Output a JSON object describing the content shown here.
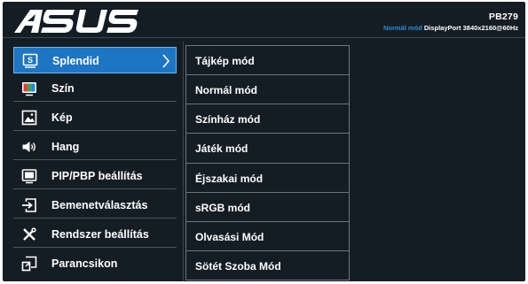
{
  "header": {
    "brand": "ASUS",
    "model": "PB279",
    "status": {
      "mode": "Normál mód",
      "port": "DisplayPort",
      "resolution": "3840x2160@60Hz"
    }
  },
  "menu": {
    "items": [
      {
        "label": "Splendid",
        "icon": "splendid-icon",
        "selected": true
      },
      {
        "label": "Szín",
        "icon": "color-icon"
      },
      {
        "label": "Kép",
        "icon": "image-icon"
      },
      {
        "label": "Hang",
        "icon": "speaker-icon"
      },
      {
        "label": "PIP/PBP beállítás",
        "icon": "pip-icon"
      },
      {
        "label": "Bemenetválasztás",
        "icon": "input-icon"
      },
      {
        "label": "Rendszer beállítás",
        "icon": "tools-icon"
      },
      {
        "label": "Parancsikon",
        "icon": "shortcut-icon"
      }
    ]
  },
  "submenu": {
    "items": [
      {
        "label": "Tájkép mód"
      },
      {
        "label": "Normál mód"
      },
      {
        "label": "Színház mód"
      },
      {
        "label": "Játék mód"
      },
      {
        "label": "Éjszakai mód"
      },
      {
        "label": "sRGB mód"
      },
      {
        "label": "Olvasási Mód"
      },
      {
        "label": "Sötét Szoba Mód"
      }
    ]
  },
  "colors": {
    "background": "#151d24",
    "selected": "#1d75c3",
    "status_mode": "#2b8ad6"
  }
}
